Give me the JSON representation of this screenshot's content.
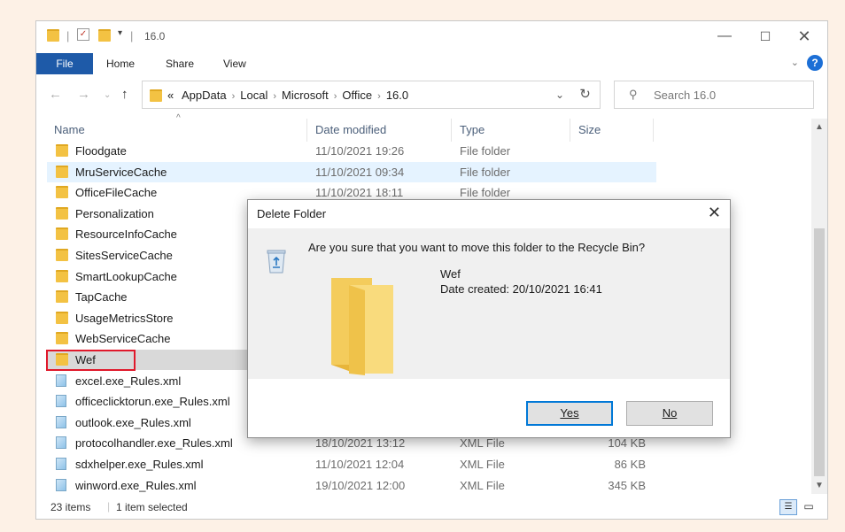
{
  "window": {
    "title": "16.0",
    "ribbon_tabs": [
      "File",
      "Home",
      "Share",
      "View"
    ],
    "help_label": "?"
  },
  "address": {
    "prefix": "«",
    "crumbs": [
      "AppData",
      "Local",
      "Microsoft",
      "Office",
      "16.0"
    ]
  },
  "search": {
    "placeholder": "Search 16.0"
  },
  "columns": {
    "name": "Name",
    "date": "Date modified",
    "type": "Type",
    "size": "Size"
  },
  "files": [
    {
      "name": "Floodgate",
      "date": "11/10/2021 19:26",
      "type": "File folder",
      "size": "",
      "kind": "folder",
      "state": "normal"
    },
    {
      "name": "MruServiceCache",
      "date": "11/10/2021 09:34",
      "type": "File folder",
      "size": "",
      "kind": "folder",
      "state": "hover"
    },
    {
      "name": "OfficeFileCache",
      "date": "11/10/2021 18:11",
      "type": "File folder",
      "size": "",
      "kind": "folder",
      "state": "normal"
    },
    {
      "name": "Personalization",
      "date": "",
      "type": "",
      "size": "",
      "kind": "folder",
      "state": "normal"
    },
    {
      "name": "ResourceInfoCache",
      "date": "",
      "type": "",
      "size": "",
      "kind": "folder",
      "state": "normal"
    },
    {
      "name": "SitesServiceCache",
      "date": "",
      "type": "",
      "size": "",
      "kind": "folder",
      "state": "normal"
    },
    {
      "name": "SmartLookupCache",
      "date": "",
      "type": "",
      "size": "",
      "kind": "folder",
      "state": "normal"
    },
    {
      "name": "TapCache",
      "date": "",
      "type": "",
      "size": "",
      "kind": "folder",
      "state": "normal"
    },
    {
      "name": "UsageMetricsStore",
      "date": "",
      "type": "",
      "size": "",
      "kind": "folder",
      "state": "normal"
    },
    {
      "name": "WebServiceCache",
      "date": "",
      "type": "",
      "size": "",
      "kind": "folder",
      "state": "normal"
    },
    {
      "name": "Wef",
      "date": "",
      "type": "",
      "size": "",
      "kind": "folder",
      "state": "selected"
    },
    {
      "name": "excel.exe_Rules.xml",
      "date": "",
      "type": "",
      "size": "",
      "kind": "xml",
      "state": "normal"
    },
    {
      "name": "officeclicktorun.exe_Rules.xml",
      "date": "",
      "type": "",
      "size": "",
      "kind": "xml",
      "state": "normal"
    },
    {
      "name": "outlook.exe_Rules.xml",
      "date": "",
      "type": "",
      "size": "",
      "kind": "xml",
      "state": "normal"
    },
    {
      "name": "protocolhandler.exe_Rules.xml",
      "date": "18/10/2021 13:12",
      "type": "XML File",
      "size": "104 KB",
      "kind": "xml",
      "state": "normal"
    },
    {
      "name": "sdxhelper.exe_Rules.xml",
      "date": "11/10/2021 12:04",
      "type": "XML File",
      "size": "86 KB",
      "kind": "xml",
      "state": "normal"
    },
    {
      "name": "winword.exe_Rules.xml",
      "date": "19/10/2021 12:00",
      "type": "XML File",
      "size": "345 KB",
      "kind": "xml",
      "state": "normal"
    }
  ],
  "status": {
    "items": "23 items",
    "selected": "1 item selected"
  },
  "dialog": {
    "title": "Delete Folder",
    "question": "Are you sure that you want to move this folder to the Recycle Bin?",
    "item_name": "Wef",
    "item_date": "Date created: 20/10/2021 16:41",
    "yes_label": "Yes",
    "no_label": "No"
  },
  "colors": {
    "file_tab": "#1e5aa8",
    "hover_row": "#e5f3ff",
    "selected_row": "#d9d9d9",
    "highlight_box": "#e0192b",
    "folder": "#f3c243"
  }
}
